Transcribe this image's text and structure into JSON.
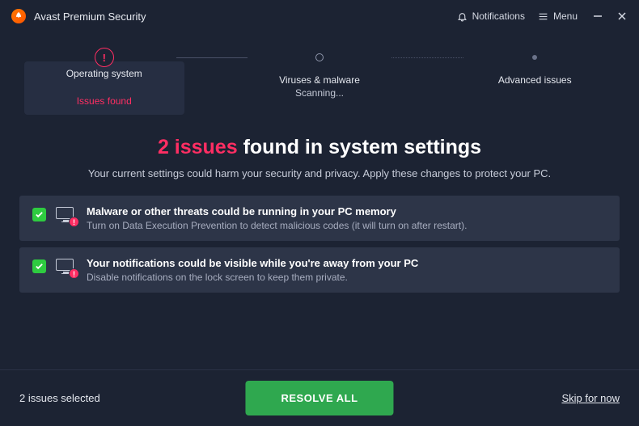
{
  "header": {
    "app_title": "Avast Premium Security",
    "notifications_label": "Notifications",
    "menu_label": "Menu"
  },
  "stepper": {
    "steps": [
      {
        "title": "Operating system",
        "subtitle": "Issues found"
      },
      {
        "title": "Viruses & malware",
        "subtitle": "Scanning..."
      },
      {
        "title": "Advanced issues",
        "subtitle": ""
      }
    ]
  },
  "headline": {
    "count": "2 issues",
    "rest": "found in system settings"
  },
  "subtext": "Your current settings could harm your security and privacy. Apply these changes to protect your PC.",
  "issues": [
    {
      "title": "Malware or other threats could be running in your PC memory",
      "desc": "Turn on Data Execution Prevention to detect malicious codes (it will turn on after restart)."
    },
    {
      "title": "Your notifications could be visible while you're away from your PC",
      "desc": "Disable notifications on the lock screen to keep them private."
    }
  ],
  "footer": {
    "selected": "2 issues selected",
    "resolve": "RESOLVE ALL",
    "skip": "Skip for now"
  },
  "colors": {
    "accent": "#ff2e63",
    "primary": "#2fa84f",
    "bg": "#1c2333"
  }
}
